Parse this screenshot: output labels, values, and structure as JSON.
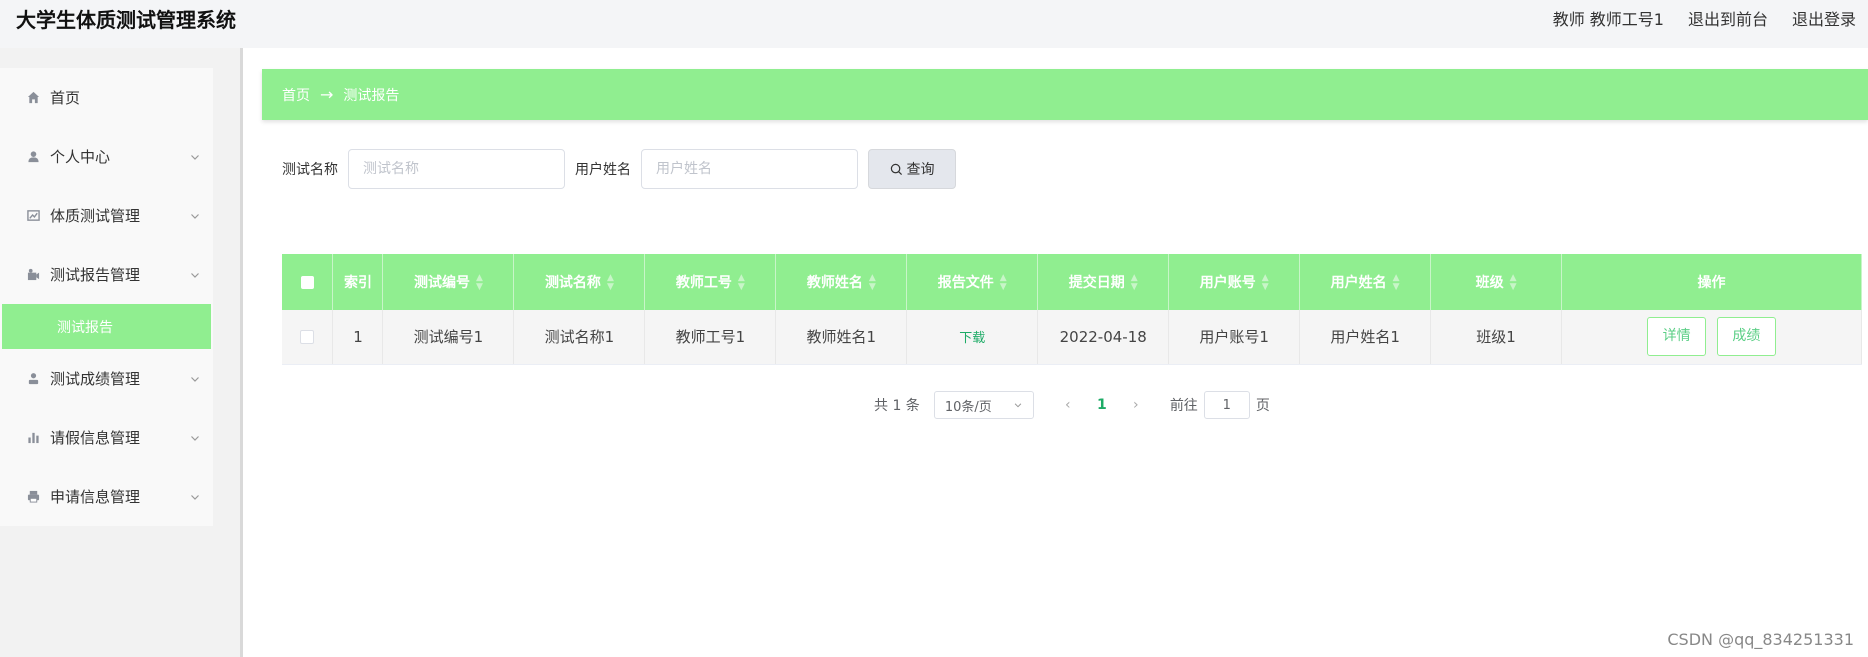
{
  "header": {
    "title": "大学生体质测试管理系统",
    "user": "教师 教师工号1",
    "to_front": "退出到前台",
    "logout": "退出登录"
  },
  "sidebar": {
    "items": [
      {
        "label": "首页",
        "icon": "home-icon"
      },
      {
        "label": "个人中心",
        "icon": "user-icon"
      },
      {
        "label": "体质测试管理",
        "icon": "chart-icon"
      },
      {
        "label": "测试报告管理",
        "icon": "report-icon"
      },
      {
        "label": "测试成绩管理",
        "icon": "person-icon"
      },
      {
        "label": "请假信息管理",
        "icon": "bars-icon"
      },
      {
        "label": "申请信息管理",
        "icon": "printer-icon"
      }
    ],
    "active_sub": "测试报告"
  },
  "breadcrumb": {
    "home": "首页",
    "arrow": "→",
    "current": "测试报告"
  },
  "search": {
    "label1": "测试名称",
    "placeholder1": "测试名称",
    "label2": "用户姓名",
    "placeholder2": "用户姓名",
    "button": "查询"
  },
  "table": {
    "headers": [
      "索引",
      "测试编号",
      "测试名称",
      "教师工号",
      "教师姓名",
      "报告文件",
      "提交日期",
      "用户账号",
      "用户姓名",
      "班级",
      "操作"
    ],
    "rows": [
      {
        "index": "1",
        "test_no": "测试编号1",
        "test_name": "测试名称1",
        "teacher_no": "教师工号1",
        "teacher_name": "教师姓名1",
        "file": "下载",
        "date": "2022-04-18",
        "account": "用户账号1",
        "user_name": "用户姓名1",
        "class": "班级1",
        "detail": "详情",
        "score": "成绩"
      }
    ]
  },
  "pager": {
    "total": "共 1 条",
    "size": "10条/页",
    "page": "1",
    "goto": "前往",
    "goto_value": "1",
    "suffix": "页"
  },
  "watermark": "CSDN @qq_834251331",
  "colors": {
    "accent": "#90ee90",
    "link": "#1dab66"
  }
}
